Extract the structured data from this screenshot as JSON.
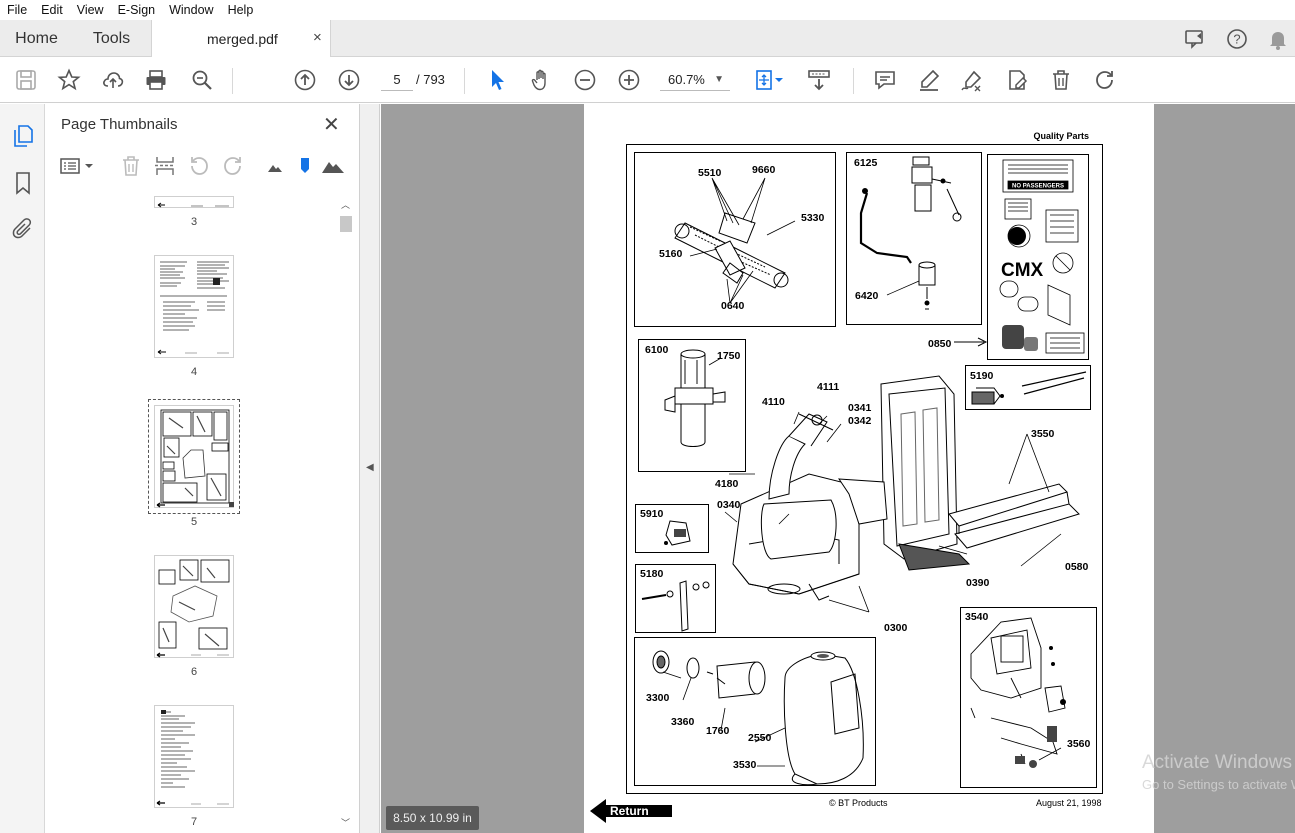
{
  "menu": [
    "File",
    "Edit",
    "View",
    "E-Sign",
    "Window",
    "Help"
  ],
  "tabs": {
    "home": "Home",
    "tools": "Tools",
    "document": "merged.pdf",
    "close": "×"
  },
  "toolbar": {
    "current_page": "5",
    "total_pages": "/ 793",
    "zoom": "60.7%"
  },
  "icons": {
    "rail": [
      "pages-icon",
      "bookmark-icon",
      "attachment-icon"
    ],
    "toolbar": [
      "save-icon",
      "star-icon",
      "upload-icon",
      "print-icon",
      "zoom-search-icon",
      "page-up-icon",
      "page-down-icon",
      "select-cursor-icon",
      "hand-icon",
      "zoom-out-icon",
      "zoom-in-icon",
      "fit-page-icon",
      "scroll-mode-icon",
      "comment-icon",
      "highlight-icon",
      "sign-icon",
      "fill-sign-icon",
      "delete-icon",
      "rotate-icon"
    ]
  },
  "thumbnails_panel": {
    "title": "Page Thumbnails",
    "close": "✕",
    "pages": [
      "3",
      "4",
      "5",
      "6",
      "7"
    ],
    "selected": "5"
  },
  "document": {
    "size_badge": "8.50 x 10.99 in",
    "header": "Quality Parts",
    "footer_center": "© BT Products",
    "footer_right": "August 21, 1998",
    "return_label": "Return",
    "part_numbers": [
      "5510",
      "9660",
      "5330",
      "5160",
      "0640",
      "6125",
      "6420",
      "0850",
      "6100",
      "1750",
      "4111",
      "4110",
      "0341",
      "0342",
      "5190",
      "3550",
      "4180",
      "0340",
      "5910",
      "0390",
      "0580",
      "5180",
      "0300",
      "3540",
      "3300",
      "3360",
      "1760",
      "2550",
      "3530",
      "3560"
    ],
    "brand_text": "CMX",
    "sticker_text": "NO PASSENGERS"
  },
  "watermark": {
    "line1": "Activate Windows",
    "line2": "Go to Settings to activate Windows."
  }
}
